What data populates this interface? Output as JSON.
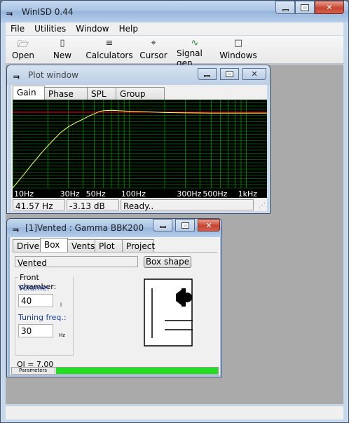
{
  "main": {
    "title": "WinISD 0.44",
    "menu": [
      "File",
      "Utilities",
      "Window",
      "Help"
    ],
    "toolbar": [
      {
        "label": "Open",
        "icon": "folder-icon"
      },
      {
        "label": "New",
        "icon": "new-project-icon"
      },
      {
        "label": "Calculators",
        "icon": "calculator-icon"
      },
      {
        "label": "Cursor",
        "icon": "cursor-icon"
      },
      {
        "label": "Signal gen.",
        "icon": "signal-generator-icon"
      },
      {
        "label": "Windows",
        "icon": "windows-icon"
      }
    ]
  },
  "plot": {
    "title": "Plot window",
    "tabs": [
      "Gain",
      "Phase plot",
      "SPL",
      "Group delay"
    ],
    "active_tab": "Gain",
    "x_ticks": [
      "10Hz",
      "30Hz",
      "50Hz",
      "100Hz",
      "300Hz",
      "500Hz",
      "1kHz"
    ],
    "status": {
      "freq": "41.57 Hz",
      "gain": "-3.13 dB",
      "state": "Ready.."
    },
    "colors": {
      "background": "#000000",
      "grid": "#00a000",
      "curve": "#ffff66",
      "reference": "#ff0000"
    }
  },
  "chart_data": {
    "type": "line",
    "xscale": "log",
    "xlim": [
      10,
      1500
    ],
    "x_ticks": [
      "10Hz",
      "30Hz",
      "50Hz",
      "100Hz",
      "300Hz",
      "500Hz",
      "1kHz"
    ],
    "series": [
      {
        "x": [
          10,
          12,
          15,
          18,
          22,
          26,
          30,
          35,
          40,
          45,
          50,
          55,
          60,
          70,
          80,
          100,
          150,
          200,
          300,
          500,
          700,
          1000,
          1500
        ],
        "values": [
          -24,
          -20.5,
          -16,
          -12.5,
          -9,
          -6.3,
          -4.6,
          -3.2,
          -2.2,
          -1.2,
          -0.5,
          0.2,
          0.5,
          0.6,
          0.5,
          0.3,
          0.1,
          -0.1,
          -0.2,
          -0.3,
          -0.3,
          -0.3,
          -0.3
        ]
      }
    ],
    "reference_line": 0,
    "ylim": [
      -24,
      4
    ]
  },
  "box": {
    "title": "[1]Vented : Gamma BBK200",
    "tabs": [
      "Driver",
      "Box",
      "Vents",
      "Plot",
      "Project"
    ],
    "active_tab": "Box",
    "box_type": "Vented",
    "box_shape_button": "Box shape",
    "front_chamber_label": "Front chamber:",
    "volume_label": "Volume:",
    "volume_value": "40",
    "volume_unit": "l",
    "tuning_label": "Tuning freq.:",
    "tuning_value": "30",
    "tuning_unit": "Hz",
    "ql": "Ql = 7.00",
    "parameters_label": "Parameters",
    "progress": 1.0,
    "progress_color": "#22dd22"
  }
}
